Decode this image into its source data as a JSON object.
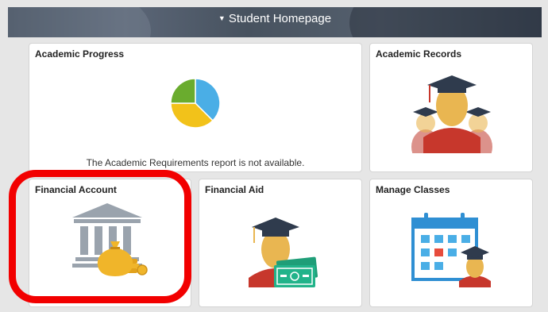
{
  "header": {
    "title": "Student Homepage",
    "expand_icon": "triangle-down-icon"
  },
  "tiles": [
    {
      "title": "Academic Progress",
      "icon": "pie-chart-icon",
      "message": "The Academic Requirements report is not available."
    },
    {
      "title": "Academic Records",
      "icon": "graduates-icon"
    },
    {
      "title": "Financial Account",
      "icon": "bank-moneybag-icon"
    },
    {
      "title": "Financial Aid",
      "icon": "graduate-money-icon"
    },
    {
      "title": "Manage Classes",
      "icon": "calendar-graduate-icon"
    }
  ],
  "colors": {
    "highlight": "#f20000",
    "pie_blue": "#4aaee6",
    "pie_yellow": "#f2c21a",
    "pie_green": "#6aac2e"
  }
}
